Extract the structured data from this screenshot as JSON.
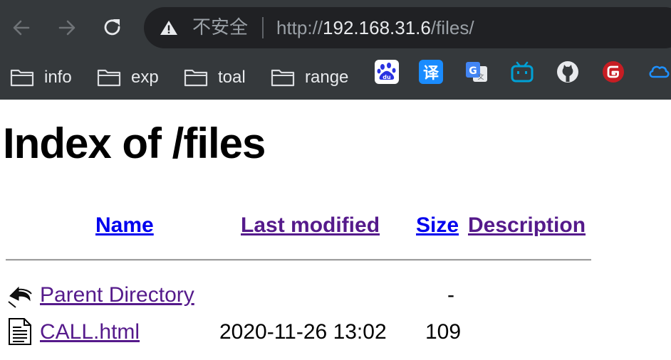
{
  "browser": {
    "security_label": "不安全",
    "url": {
      "scheme": "http://",
      "host": "192.168.31.6",
      "path": "/files/"
    },
    "bookmarks": [
      {
        "label": "info",
        "icon": "folder-icon"
      },
      {
        "label": "exp",
        "icon": "folder-icon"
      },
      {
        "label": "toal",
        "icon": "folder-icon"
      },
      {
        "label": "range",
        "icon": "folder-icon"
      }
    ],
    "bookmark_icons": [
      {
        "name": "baidu-icon",
        "glyph": "du",
        "color": "#2932e1"
      },
      {
        "name": "translate-icon",
        "glyph": "译",
        "color": "#1a8cff"
      },
      {
        "name": "google-translate-icon",
        "glyph": "G",
        "color": "#4285f4"
      },
      {
        "name": "bilibili-icon",
        "glyph": "bili",
        "color": "#00a1d6"
      },
      {
        "name": "github-icon",
        "glyph": "gh",
        "color": "#ffffff"
      },
      {
        "name": "gitee-icon",
        "glyph": "G",
        "color": "#c71d23"
      },
      {
        "name": "cloud-icon",
        "glyph": "cloud",
        "color": "#1e90ff"
      }
    ]
  },
  "page": {
    "title": "Index of /files",
    "columns": {
      "name": "Name",
      "last_modified": "Last modified",
      "size": "Size",
      "description": "Description"
    },
    "rows": [
      {
        "icon": "back-arrow-icon",
        "name": "Parent Directory",
        "last_modified": "",
        "size": "-",
        "description": ""
      },
      {
        "icon": "text-file-icon",
        "name": "CALL.html",
        "last_modified": "2020-11-26 13:02",
        "size": "109",
        "description": ""
      }
    ]
  },
  "colors": {
    "chrome_bg": "#35393c",
    "omnibox_bg": "#202124",
    "link": "#0000ee",
    "visited_link": "#551a8b"
  }
}
